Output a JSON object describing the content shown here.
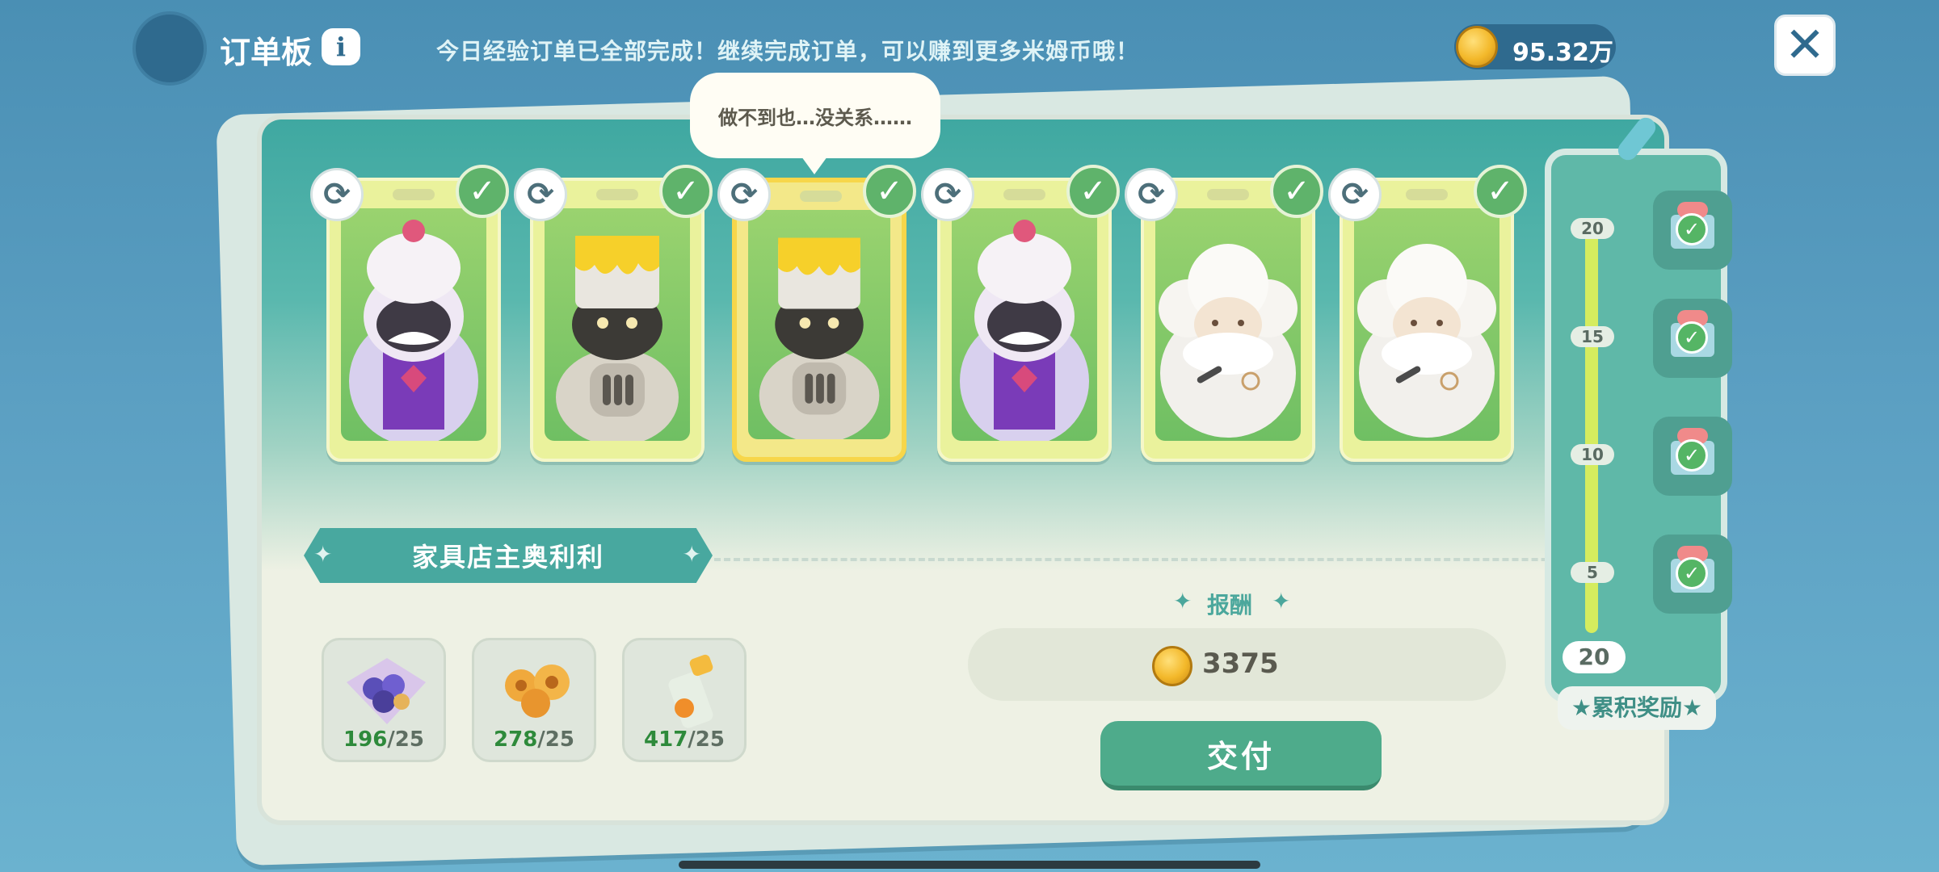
{
  "header": {
    "title": "订单板",
    "info_label": "i",
    "notice": "今日经验订单已全部完成！继续完成订单，可以赚到更多米姆币哦！",
    "coins": "95.32万",
    "close_label": "✕"
  },
  "bubble": {
    "text": "做不到也…没关系……"
  },
  "cards": [
    {
      "character": "purple-turban-chef",
      "selected": false,
      "completed": true
    },
    {
      "character": "paint-bucket-robot",
      "selected": false,
      "completed": true
    },
    {
      "character": "paint-bucket-robot",
      "selected": true,
      "completed": true
    },
    {
      "character": "purple-turban-chef",
      "selected": false,
      "completed": true
    },
    {
      "character": "fluffy-sheep",
      "selected": false,
      "completed": true
    },
    {
      "character": "fluffy-sheep",
      "selected": false,
      "completed": true
    }
  ],
  "order": {
    "customer_name": "家具店主奥利利",
    "materials": [
      {
        "icon": "purple-flower-bouquet",
        "have": "196",
        "need": "/25"
      },
      {
        "icon": "orange-flower-bouquet",
        "have": "278",
        "need": "/25"
      },
      {
        "icon": "jam-jar",
        "have": "417",
        "need": "/25"
      }
    ],
    "reward_label": "报酬",
    "reward_value": "3375",
    "deliver_label": "交付"
  },
  "cumulative": {
    "ticks": [
      "20",
      "15",
      "10",
      "5"
    ],
    "current": "20",
    "label": "累积奖励",
    "check": "✓"
  },
  "colors": {
    "accent": "#4eab8b",
    "teal": "#48a89f",
    "count_green": "#2e8a3b"
  }
}
